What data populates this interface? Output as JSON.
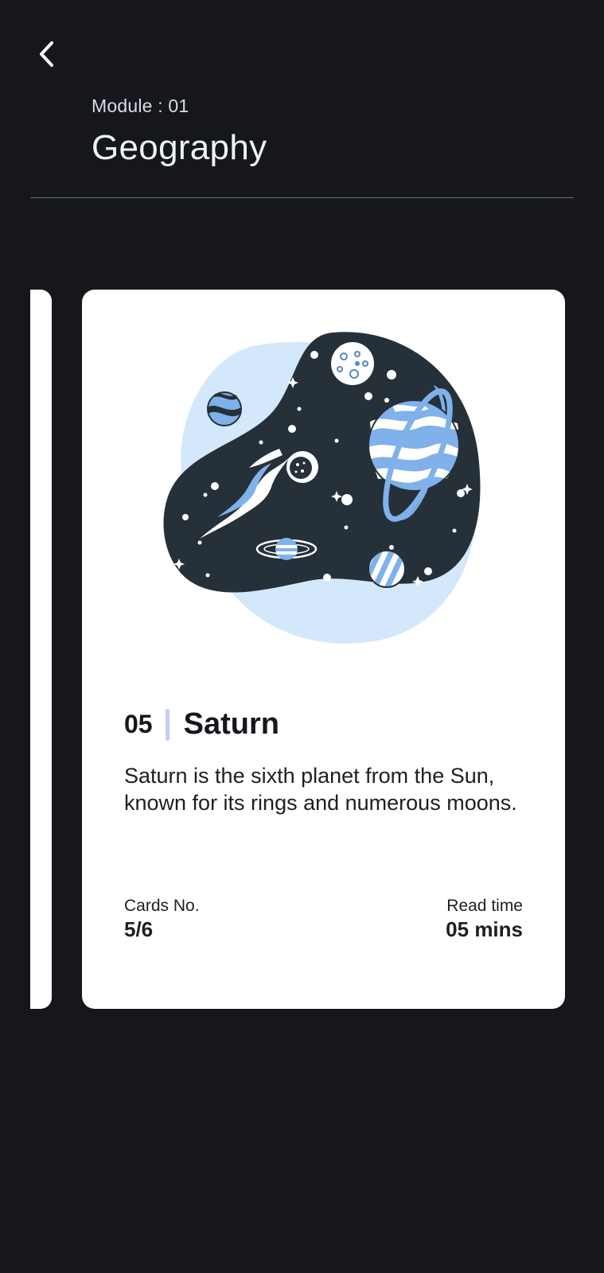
{
  "header": {
    "back_icon": "chevron-left-icon",
    "module_label": "Module : 01",
    "module_title": "Geography"
  },
  "card": {
    "illustration": "space-planets-illustration",
    "number": "05",
    "title": "Saturn",
    "description": "Saturn is the sixth planet from the Sun, known for its rings and numerous moons.",
    "cards_label": "Cards No.",
    "cards_value": "5/6",
    "read_time_label": "Read time",
    "read_time_value": "05 mins"
  },
  "colors": {
    "background": "#15171c",
    "card": "#ffffff",
    "accent_light_blue": "#d4e8fb",
    "planet_blue": "#7fb1ea",
    "space_dark": "#263039",
    "separator": "#c6cef3"
  }
}
